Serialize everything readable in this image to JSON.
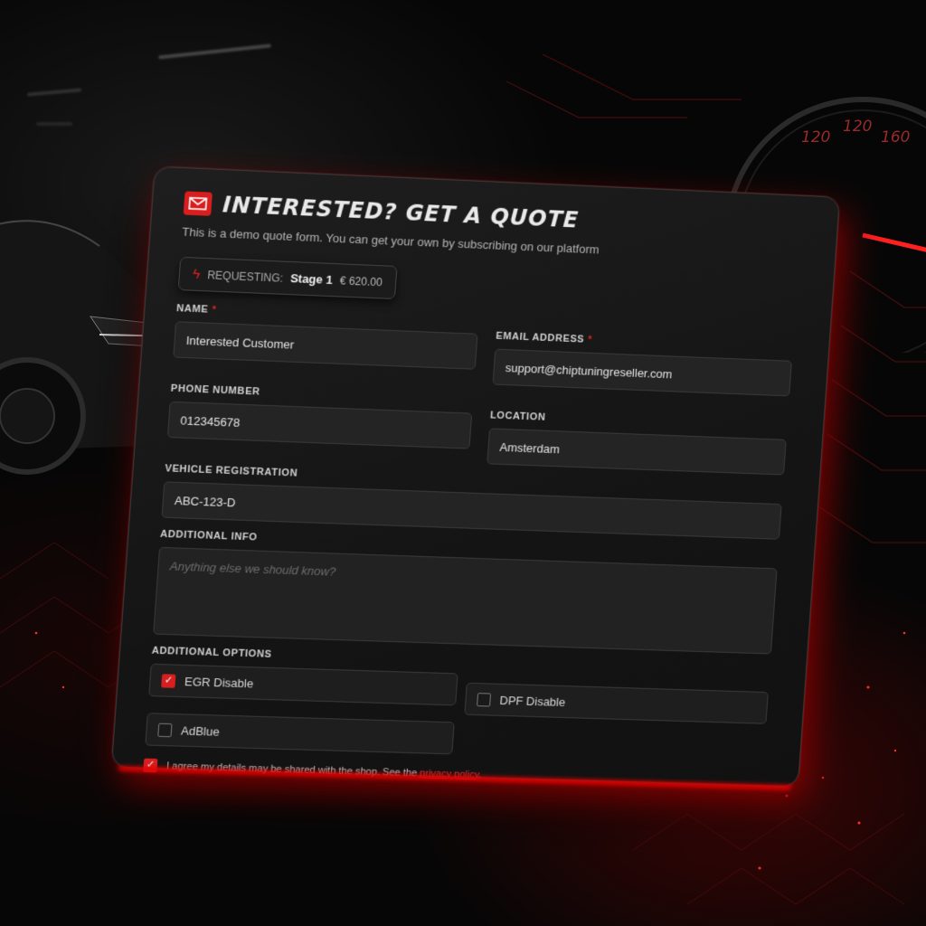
{
  "form": {
    "title": "INTERESTED? GET A QUOTE",
    "subtitle": "This is a demo quote form. You can get your own by subscribing on our platform",
    "requesting": {
      "prefix": "REQUESTING:",
      "stage": "Stage 1",
      "price": "€ 620.00"
    },
    "fields": {
      "name": {
        "label": "NAME",
        "value": "Interested Customer",
        "required": "*"
      },
      "email": {
        "label": "EMAIL ADDRESS",
        "value": "support@chiptuningreseller.com",
        "required": "*"
      },
      "phone": {
        "label": "PHONE NUMBER",
        "value": "012345678"
      },
      "location": {
        "label": "LOCATION",
        "value": "Amsterdam"
      },
      "vehicle": {
        "label": "VEHICLE REGISTRATION",
        "value": "ABC-123-D"
      },
      "info": {
        "label": "ADDITIONAL INFO",
        "placeholder": "Anything else we should know?"
      }
    },
    "options_label": "ADDITIONAL OPTIONS",
    "options": [
      {
        "label": "EGR Disable",
        "checked": true
      },
      {
        "label": "DPF Disable",
        "checked": false
      },
      {
        "label": "AdBlue",
        "checked": false
      }
    ],
    "agree": {
      "text": "I agree my details may be shared with the shop. See the",
      "link": "privacy policy",
      "end": ".",
      "checked": true
    }
  },
  "gauge": {
    "labels": [
      "120",
      "120",
      "160"
    ]
  },
  "colors": {
    "accent": "#d61f1f",
    "panel": "#161616"
  }
}
